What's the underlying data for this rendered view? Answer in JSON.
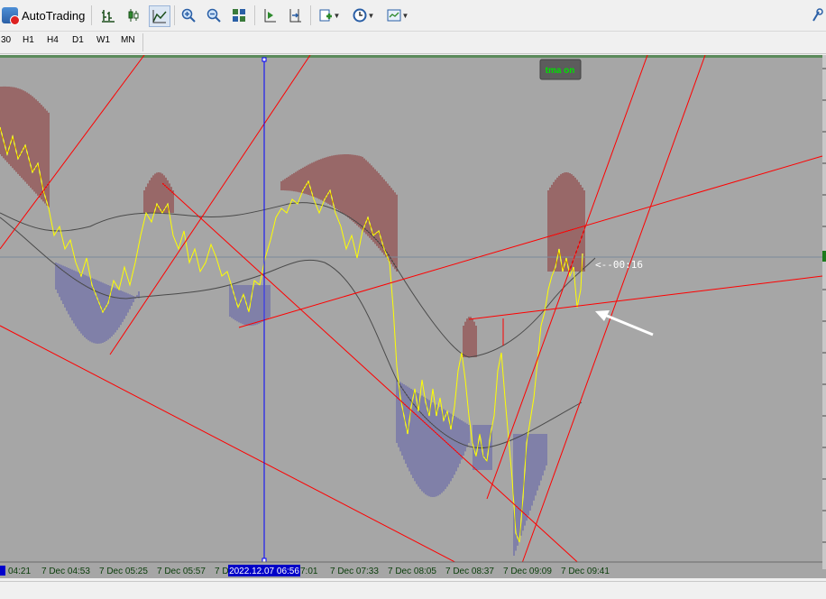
{
  "toolbar": {
    "autotrading_label": "AutoTrading",
    "buttons": [
      "bar-chart-icon",
      "candlestick-icon",
      "line-chart-icon",
      "zoom-in-icon",
      "zoom-out-icon",
      "tile-windows-icon",
      "chart-shift-icon",
      "autoscroll-icon",
      "indicators-icon",
      "periods-icon",
      "templates-icon"
    ]
  },
  "timeframes": [
    "30",
    "H1",
    "H4",
    "D1",
    "W1",
    "MN"
  ],
  "chart": {
    "tma_label": "tma on",
    "countdown": "<--00:16",
    "crosshair_time": "2022.12.07 06:56",
    "x_ticks": [
      "04:21",
      "7 Dec 04:53",
      "7 Dec 05:25",
      "7 Dec 05:57",
      "7 D",
      "7:01",
      "7 Dec 07:33",
      "7 Dec 08:05",
      "7 Dec 08:37",
      "7 Dec 09:09",
      "7 Dec 09:41"
    ],
    "colors": {
      "background": "#a6a6a6",
      "price_line": "#ffff00",
      "trend_lines": "#ff0000",
      "upper_histogram": "#8b2a2a",
      "lower_histogram": "#5a5aaa",
      "crosshair": "#0000ff",
      "tick_text": "#0a3d0a"
    }
  }
}
